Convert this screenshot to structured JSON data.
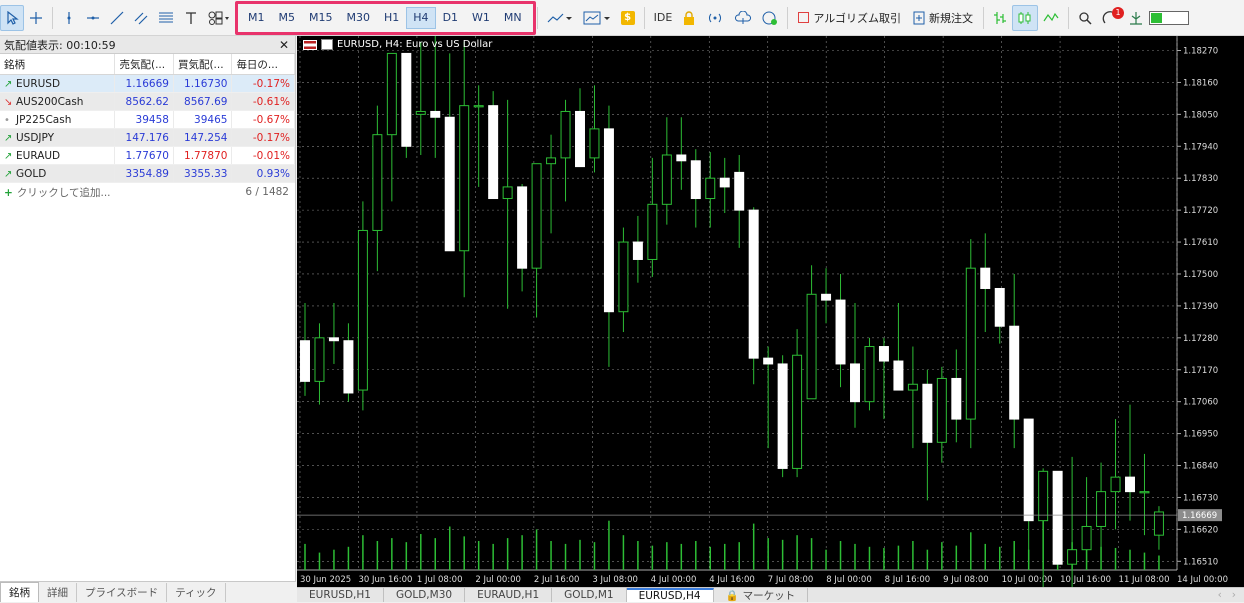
{
  "toolbar": {
    "timeframes": [
      "M1",
      "M5",
      "M15",
      "M30",
      "H1",
      "H4",
      "D1",
      "W1",
      "MN"
    ],
    "active_timeframe": "H4",
    "ide_label": "IDE",
    "algo_label": "アルゴリズム取引",
    "new_order_label": "新規注文",
    "notification_count": "1",
    "balance_fill": 0.3
  },
  "market_watch": {
    "title": "気配値表示: 00:10:59",
    "headers": [
      "銘柄",
      "売気配(...",
      "買気配(...",
      "毎日の..."
    ],
    "rows": [
      {
        "symbol": "EURUSD",
        "bid": "1.16669",
        "ask": "1.16730",
        "change": "-0.17%",
        "trend": "up"
      },
      {
        "symbol": "AUS200Cash",
        "bid": "8562.62",
        "ask": "8567.69",
        "change": "-0.61%",
        "trend": "down"
      },
      {
        "symbol": "JP225Cash",
        "bid": "39458",
        "ask": "39465",
        "change": "-0.67%",
        "trend": "flat"
      },
      {
        "symbol": "USDJPY",
        "bid": "147.176",
        "ask": "147.254",
        "change": "-0.17%",
        "trend": "up"
      },
      {
        "symbol": "EURAUD",
        "bid": "1.77670",
        "ask": "1.77870",
        "change": "-0.01%",
        "trend": "up"
      },
      {
        "symbol": "GOLD",
        "bid": "3354.89",
        "ask": "3355.33",
        "change": "0.93%",
        "trend": "up"
      }
    ],
    "add_label": "クリックして追加...",
    "count": "6 / 1482",
    "tabs": [
      "銘柄",
      "詳細",
      "プライスボード",
      "ティック"
    ]
  },
  "chart_tabs": [
    "EURUSD,H1",
    "GOLD,M30",
    "EURAUD,H1",
    "GOLD,M1",
    "EURUSD,H4",
    "マーケット"
  ],
  "active_chart_tab": "EURUSD,H4",
  "chart_data": {
    "type": "candlestick",
    "title": "EURUSD, H4: Euro vs US Dollar",
    "current_price": 1.16669,
    "price_label": "1.16669",
    "ylim": [
      1.1648,
      1.1832
    ],
    "y_ticks": [
      "1.18270",
      "1.18160",
      "1.18050",
      "1.17940",
      "1.17830",
      "1.17720",
      "1.17610",
      "1.17500",
      "1.17390",
      "1.17280",
      "1.17170",
      "1.17060",
      "1.16950",
      "1.16840",
      "1.16730",
      "1.16620",
      "1.16510"
    ],
    "x_ticks": [
      "30 Jun 2025",
      "30 Jun 16:00",
      "1 Jul 08:00",
      "2 Jul 00:00",
      "2 Jul 16:00",
      "3 Jul 08:00",
      "4 Jul 00:00",
      "4 Jul 16:00",
      "7 Jul 08:00",
      "8 Jul 00:00",
      "8 Jul 16:00",
      "9 Jul 08:00",
      "10 Jul 00:00",
      "10 Jul 16:00",
      "11 Jul 08:00",
      "14 Jul 00:00"
    ],
    "candles": [
      [
        1.1727,
        1.174,
        1.1708,
        1.1713
      ],
      [
        1.1713,
        1.1733,
        1.1705,
        1.1728
      ],
      [
        1.1728,
        1.174,
        1.1719,
        1.1727
      ],
      [
        1.1727,
        1.1733,
        1.1706,
        1.1709
      ],
      [
        1.171,
        1.1775,
        1.1703,
        1.1765
      ],
      [
        1.1765,
        1.1808,
        1.1751,
        1.1798
      ],
      [
        1.1798,
        1.182,
        1.1775,
        1.1826
      ],
      [
        1.1826,
        1.1813,
        1.179,
        1.1794
      ],
      [
        1.1805,
        1.183,
        1.1791,
        1.1806
      ],
      [
        1.1806,
        1.1836,
        1.179,
        1.1804
      ],
      [
        1.1804,
        1.1826,
        1.1758,
        1.1758
      ],
      [
        1.1758,
        1.183,
        1.1742,
        1.1808
      ],
      [
        1.1808,
        1.1815,
        1.178,
        1.1808
      ],
      [
        1.1808,
        1.1813,
        1.1784,
        1.1776
      ],
      [
        1.1776,
        1.181,
        1.1738,
        1.178
      ],
      [
        1.178,
        1.1781,
        1.1744,
        1.1752
      ],
      [
        1.1752,
        1.1788,
        1.1735,
        1.1788
      ],
      [
        1.1788,
        1.1798,
        1.1764,
        1.179
      ],
      [
        1.179,
        1.181,
        1.1775,
        1.1806
      ],
      [
        1.1806,
        1.1814,
        1.1789,
        1.1787
      ],
      [
        1.179,
        1.1815,
        1.1785,
        1.18
      ],
      [
        1.18,
        1.1808,
        1.1718,
        1.1737
      ],
      [
        1.1737,
        1.1766,
        1.173,
        1.1761
      ],
      [
        1.1761,
        1.177,
        1.1747,
        1.1755
      ],
      [
        1.1755,
        1.179,
        1.1749,
        1.1774
      ],
      [
        1.1774,
        1.1804,
        1.1767,
        1.1791
      ],
      [
        1.1791,
        1.1804,
        1.1779,
        1.1789
      ],
      [
        1.1789,
        1.1793,
        1.1766,
        1.1776
      ],
      [
        1.1776,
        1.1792,
        1.1766,
        1.1783
      ],
      [
        1.1783,
        1.179,
        1.1771,
        1.178
      ],
      [
        1.1785,
        1.1791,
        1.1759,
        1.1772
      ],
      [
        1.1772,
        1.1773,
        1.1712,
        1.1721
      ],
      [
        1.1721,
        1.1725,
        1.169,
        1.1719
      ],
      [
        1.1719,
        1.1722,
        1.168,
        1.1683
      ],
      [
        1.1683,
        1.1731,
        1.168,
        1.1722
      ],
      [
        1.1707,
        1.1753,
        1.1709,
        1.1743
      ],
      [
        1.1743,
        1.1752,
        1.1733,
        1.1741
      ],
      [
        1.1741,
        1.175,
        1.1711,
        1.1719
      ],
      [
        1.1719,
        1.174,
        1.1697,
        1.1706
      ],
      [
        1.1706,
        1.1728,
        1.1703,
        1.1725
      ],
      [
        1.1725,
        1.1728,
        1.17,
        1.172
      ],
      [
        1.172,
        1.174,
        1.171,
        1.171
      ],
      [
        1.171,
        1.1725,
        1.169,
        1.1712
      ],
      [
        1.1712,
        1.1717,
        1.1672,
        1.1692
      ],
      [
        1.1692,
        1.1718,
        1.1685,
        1.1714
      ],
      [
        1.1714,
        1.1724,
        1.1692,
        1.17
      ],
      [
        1.17,
        1.1762,
        1.169,
        1.1752
      ],
      [
        1.1752,
        1.1764,
        1.173,
        1.1745
      ],
      [
        1.1745,
        1.1745,
        1.1726,
        1.1732
      ],
      [
        1.1732,
        1.175,
        1.169,
        1.17
      ],
      [
        1.17,
        1.17,
        1.165,
        1.1665
      ],
      [
        1.1665,
        1.1683,
        1.163,
        1.1682
      ],
      [
        1.1682,
        1.1682,
        1.166,
        1.165
      ],
      [
        1.165,
        1.1687,
        1.163,
        1.1655
      ],
      [
        1.1655,
        1.168,
        1.165,
        1.1663
      ],
      [
        1.1663,
        1.1685,
        1.1655,
        1.1675
      ],
      [
        1.1675,
        1.17,
        1.1662,
        1.168
      ],
      [
        1.168,
        1.1705,
        1.1665,
        1.1675
      ],
      [
        1.1675,
        1.1688,
        1.166,
        1.1675
      ],
      [
        1.166,
        1.167,
        1.1655,
        1.1668
      ]
    ],
    "volumes": [
      0.45,
      0.3,
      0.35,
      0.4,
      0.6,
      0.5,
      0.55,
      0.48,
      0.62,
      0.55,
      0.75,
      0.58,
      0.5,
      0.45,
      0.55,
      0.6,
      0.7,
      0.5,
      0.45,
      0.52,
      0.48,
      0.85,
      0.6,
      0.5,
      0.42,
      0.48,
      0.45,
      0.5,
      0.4,
      0.45,
      0.48,
      0.8,
      0.55,
      0.52,
      0.6,
      0.55,
      0.35,
      0.5,
      0.45,
      0.4,
      0.38,
      0.42,
      0.5,
      0.35,
      0.48,
      0.42,
      0.65,
      0.45,
      0.4,
      0.5,
      0.35,
      0.85,
      0.6,
      0.48,
      0.45,
      0.4,
      0.38,
      0.35,
      0.3,
      0.25
    ]
  }
}
